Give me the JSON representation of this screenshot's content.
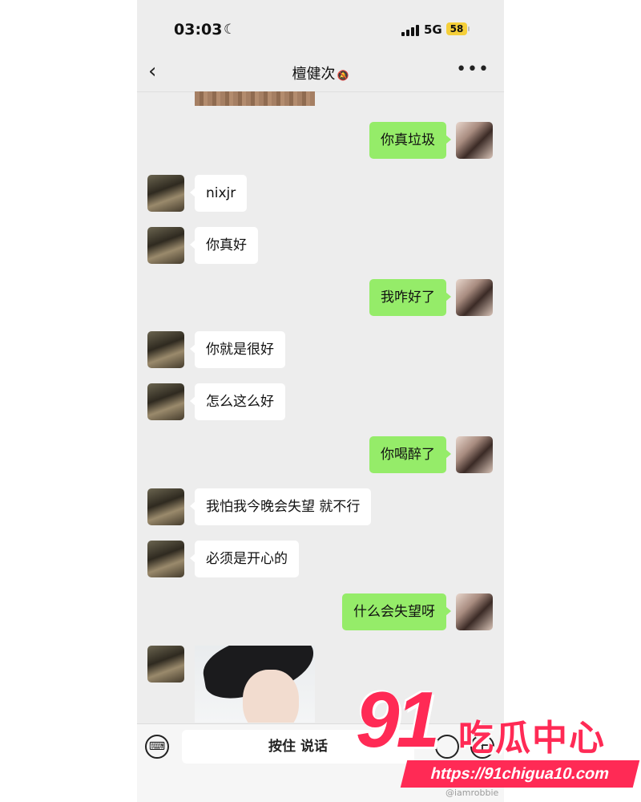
{
  "status_bar": {
    "time": "03:03",
    "network": "5G",
    "battery": "58"
  },
  "header": {
    "back_icon": "chevron-left-icon",
    "title": "檀健次",
    "mute_icon": "bell-off-icon",
    "more_icon": "more-dots-icon"
  },
  "messages": [
    {
      "from": "me",
      "text": "你真垃圾"
    },
    {
      "from": "them",
      "text": "nixjr"
    },
    {
      "from": "them",
      "text": "你真好"
    },
    {
      "from": "me",
      "text": "我咋好了"
    },
    {
      "from": "them",
      "text": "你就是很好"
    },
    {
      "from": "them",
      "text": "怎么这么好"
    },
    {
      "from": "me",
      "text": "你喝醉了"
    },
    {
      "from": "them",
      "text": "我怕我今晚会失望 就不行"
    },
    {
      "from": "them",
      "text": "必须是开心的"
    },
    {
      "from": "me",
      "text": "什么会失望呀"
    },
    {
      "from": "them",
      "type": "image"
    }
  ],
  "input_bar": {
    "voice_label": "按住 说话",
    "keyboard_icon": "keyboard-icon",
    "emoji_icon": "emoji-icon",
    "plus_icon": "plus-icon"
  },
  "watermark": {
    "number": "91",
    "name": "吃瓜中心",
    "url": "https://91chigua10.com",
    "credit": "@iamrobbie"
  },
  "colors": {
    "me_bubble": "#95ec69",
    "them_bubble": "#ffffff",
    "background": "#ededed",
    "watermark": "#ff2a55"
  }
}
